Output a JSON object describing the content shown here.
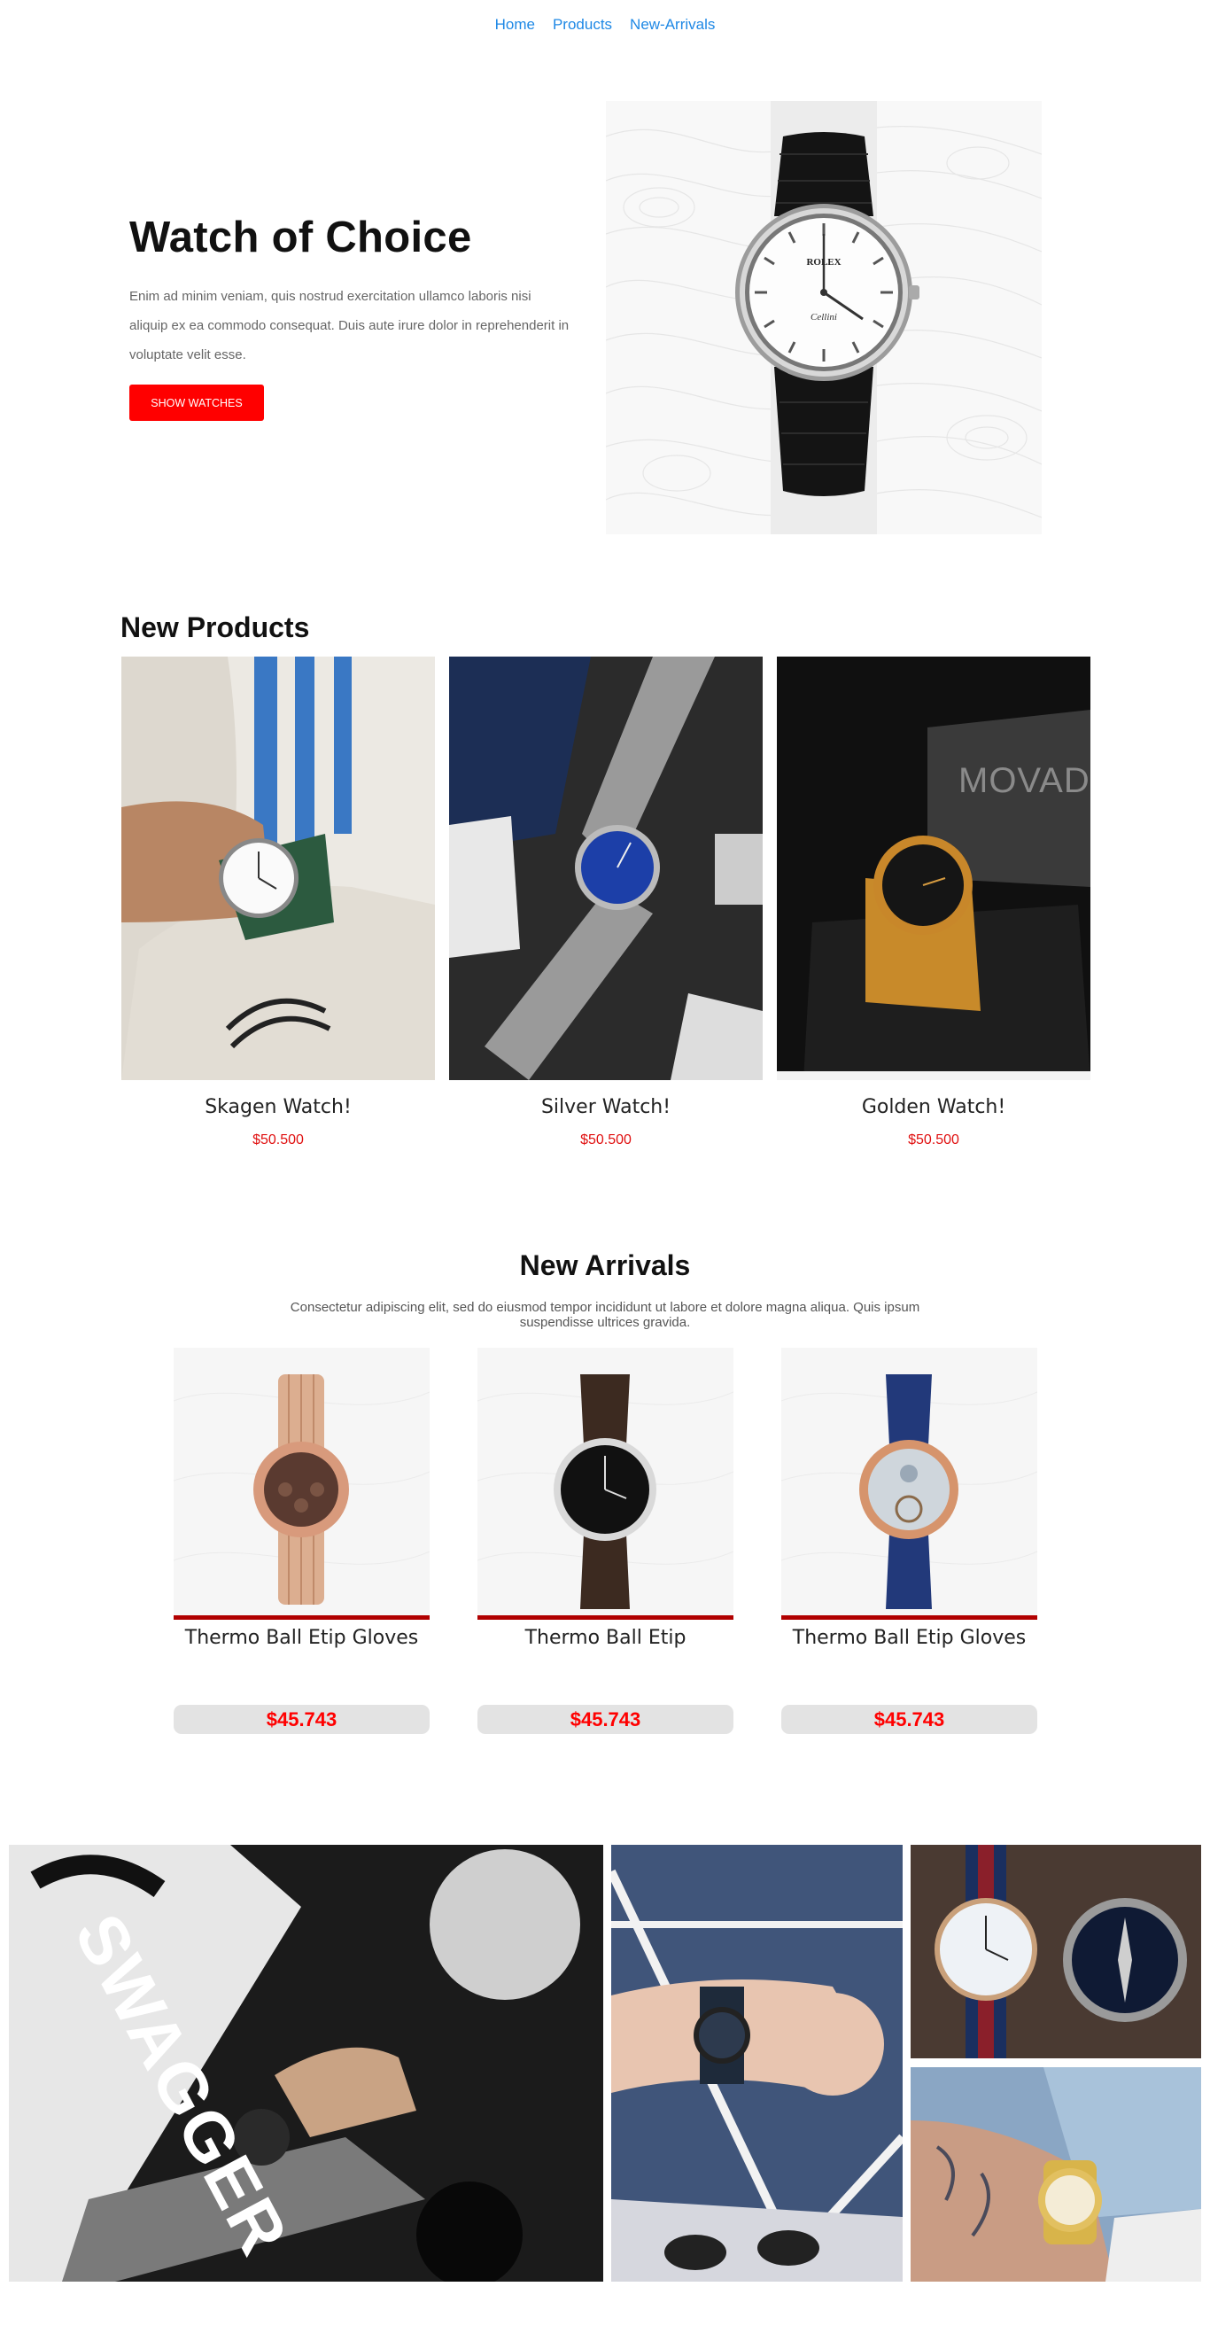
{
  "nav": {
    "items": [
      "Home",
      "Products",
      "New-Arrivals"
    ]
  },
  "hero": {
    "title": "Watch of Choice",
    "text": "Enim ad minim veniam, quis nostrud exercitation ullamco laboris nisi aliquip ex ea commodo consequat. Duis aute irure dolor in reprehenderit in voluptate velit esse.",
    "button": "SHOW WATCHES",
    "watch_brand": "ROLEX",
    "watch_model": "Cellini"
  },
  "new_products": {
    "title": "New Products",
    "items": [
      {
        "name": "Skagen Watch!",
        "price": "$50.500"
      },
      {
        "name": "Silver Watch!",
        "price": "$50.500"
      },
      {
        "name": "Golden Watch!",
        "price": "$50.500",
        "box_text": "MOVADO"
      }
    ]
  },
  "new_arrivals": {
    "title": "New Arrivals",
    "subtitle": "Consectetur adipiscing elit, sed do eiusmod tempor incididunt ut labore et dolore magna aliqua. Quis ipsum suspendisse ultrices gravida.",
    "items": [
      {
        "name": "Thermo Ball Etip Gloves",
        "price": "$45.743"
      },
      {
        "name": "Thermo Ball Etip",
        "price": "$45.743"
      },
      {
        "name": "Thermo Ball Etip Gloves",
        "price": "$45.743"
      }
    ]
  },
  "gallery": {
    "magazine_text": "SWAGGER"
  },
  "colors": {
    "accent": "#ff0000",
    "link": "#1e88e5",
    "arrival_bar": "#b10000",
    "price_pill": "#e3e3e3"
  }
}
